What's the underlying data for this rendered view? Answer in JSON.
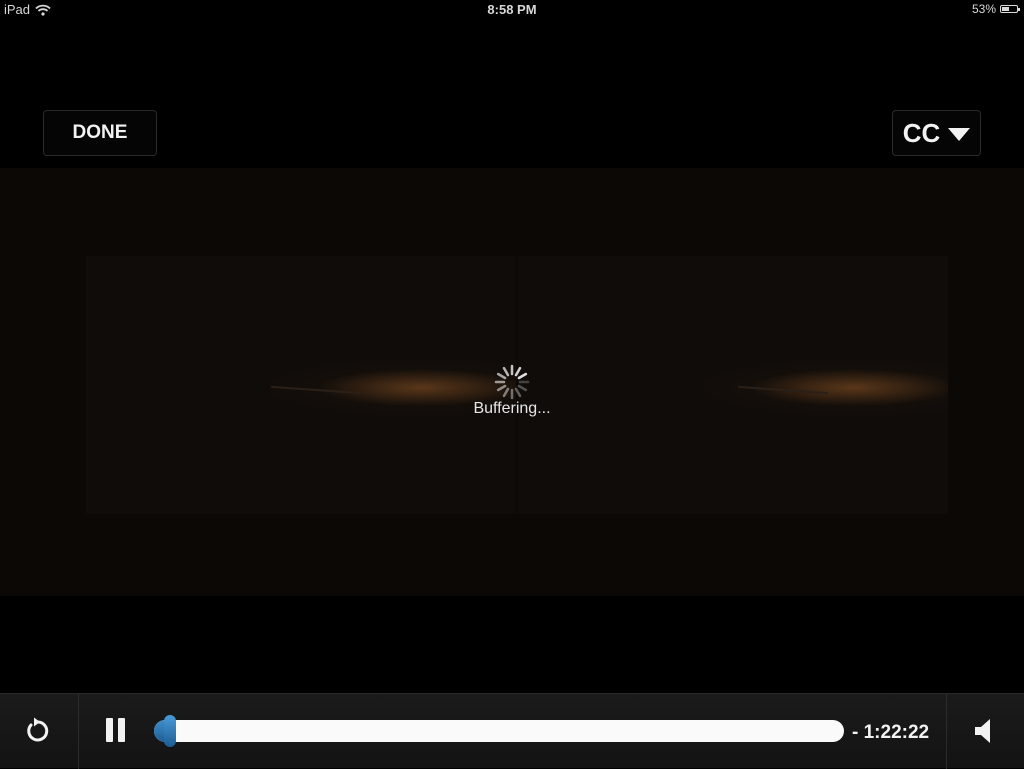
{
  "status_bar": {
    "device": "iPad",
    "time": "8:58 PM",
    "battery_percent": "53%",
    "battery_level": 0.53
  },
  "player": {
    "done_label": "DONE",
    "cc_label": "CC",
    "buffering_text": "Buffering...",
    "time_remaining": "- 1:22:22",
    "progress": 0.01
  },
  "icons": {
    "wifi": "wifi-icon",
    "replay": "replay-icon",
    "pause": "pause-icon",
    "volume": "volume-icon",
    "spinner": "spinner-icon",
    "cc_dropdown": "chevron-down-icon"
  },
  "colors": {
    "scrubber_accent": "#2a74b3",
    "background": "#000000"
  }
}
